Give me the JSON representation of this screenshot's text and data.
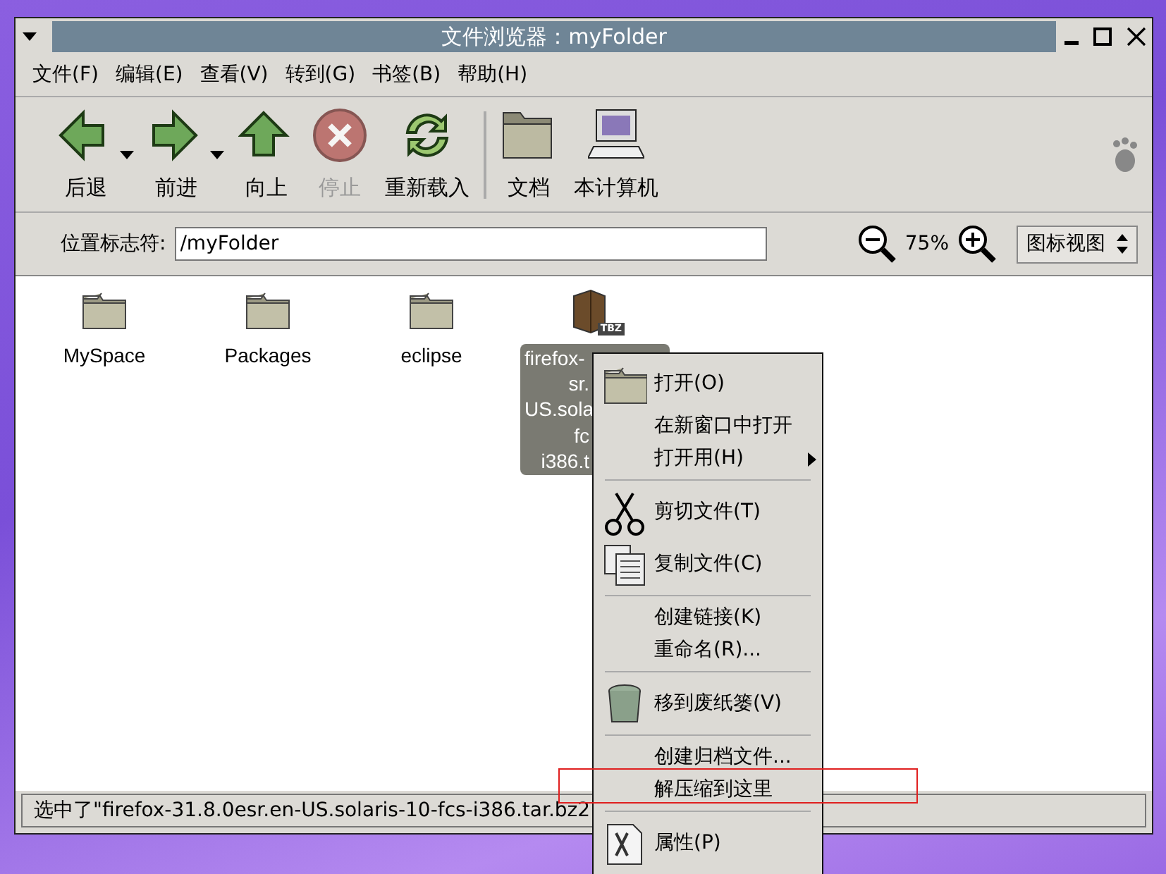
{
  "window": {
    "title": "文件浏览器：myFolder"
  },
  "menubar": [
    "文件(F)",
    "编辑(E)",
    "查看(V)",
    "转到(G)",
    "书签(B)",
    "帮助(H)"
  ],
  "toolbar": [
    {
      "kind": "back",
      "label": "后退",
      "disabled": false,
      "dropdown": true
    },
    {
      "kind": "forward",
      "label": "前进",
      "disabled": false,
      "dropdown": true
    },
    {
      "kind": "up",
      "label": "向上",
      "disabled": false,
      "dropdown": false
    },
    {
      "kind": "stop",
      "label": "停止",
      "disabled": true,
      "dropdown": false
    },
    {
      "kind": "reload",
      "label": "重新载入",
      "disabled": false,
      "dropdown": false
    },
    {
      "kind": "separator"
    },
    {
      "kind": "documents",
      "label": "文档",
      "disabled": false,
      "dropdown": false
    },
    {
      "kind": "computer",
      "label": "本计算机",
      "disabled": false,
      "dropdown": false
    }
  ],
  "location": {
    "label": "位置标志符:",
    "value": "/myFolder",
    "zoom": "75%",
    "view": "图标视图"
  },
  "files": [
    {
      "kind": "folder",
      "lines": [
        "MySpace"
      ],
      "selected": false
    },
    {
      "kind": "folder",
      "lines": [
        "Packages"
      ],
      "selected": false
    },
    {
      "kind": "folder",
      "lines": [
        "eclipse"
      ],
      "selected": false
    },
    {
      "kind": "archive",
      "badge": "TBZ",
      "lines": [
        "firefox-",
        "sr.",
        "US.sola",
        "fc",
        "i386.t"
      ],
      "selected": true
    }
  ],
  "context_menu": [
    {
      "kind": "open",
      "label": "打开(O)",
      "submenu": false
    },
    {
      "kind": "plain",
      "label": "在新窗口中打开",
      "submenu": false
    },
    {
      "kind": "plain",
      "label": "打开用(H)",
      "submenu": true
    },
    {
      "kind": "separator"
    },
    {
      "kind": "cut",
      "label": "剪切文件(T)",
      "submenu": false
    },
    {
      "kind": "copy",
      "label": "复制文件(C)",
      "submenu": false
    },
    {
      "kind": "separator"
    },
    {
      "kind": "plain",
      "label": "创建链接(K)",
      "submenu": false
    },
    {
      "kind": "plain",
      "label": "重命名(R)...",
      "submenu": false
    },
    {
      "kind": "separator"
    },
    {
      "kind": "trash",
      "label": "移到废纸篓(V)",
      "submenu": false
    },
    {
      "kind": "separator"
    },
    {
      "kind": "plain",
      "label": "创建归档文件...",
      "submenu": false
    },
    {
      "kind": "plain",
      "label": "解压缩到这里",
      "submenu": false
    },
    {
      "kind": "separator"
    },
    {
      "kind": "properties",
      "label": "属性(P)",
      "submenu": false
    }
  ],
  "status_bar": "选中了\"firefox-31.8.0esr.en-US.solaris-10-fcs-i386.tar.bz2"
}
